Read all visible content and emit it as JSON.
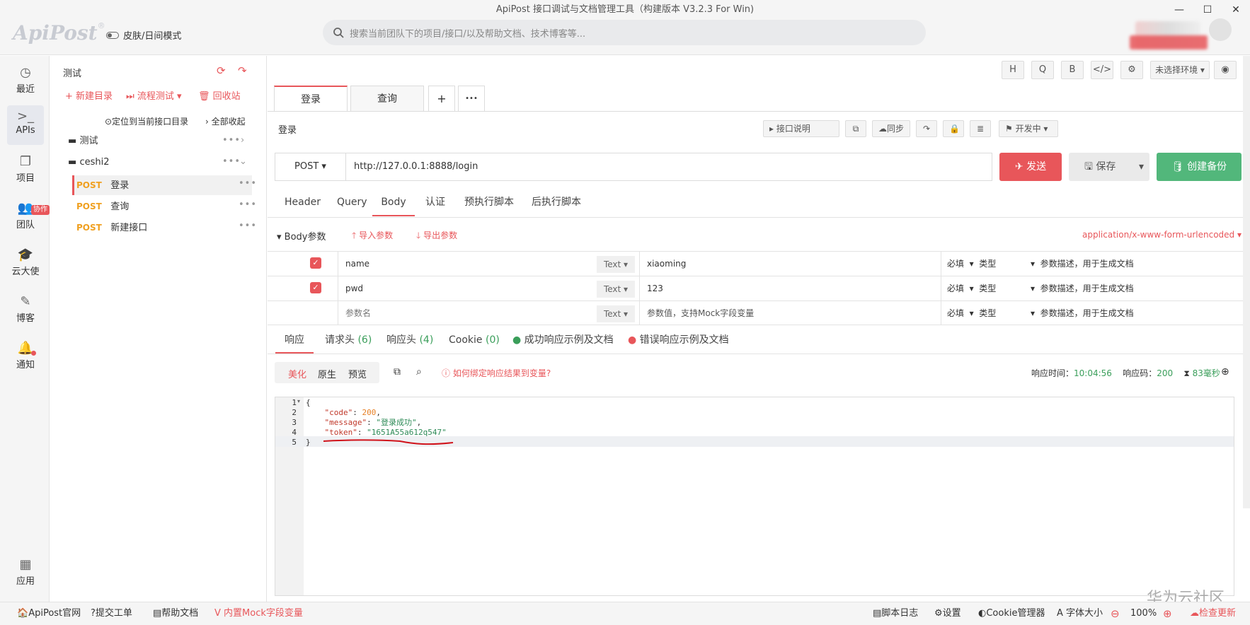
{
  "window": {
    "title": "ApiPost 接口调试与文档管理工具（构建版本 V3.2.3 For Win)",
    "min": "—",
    "max": "☐",
    "close": "✕"
  },
  "top": {
    "logo": "ApiPost",
    "logo_mark": "®",
    "skin_label": "皮肤/日间模式",
    "search_placeholder": "搜索当前团队下的项目/接口/以及帮助文档、技术博客等..."
  },
  "nav": {
    "recent": "最近",
    "apis": "APIs",
    "project": "项目",
    "team": "团队",
    "team_badge": "协作",
    "cloud": "云大使",
    "blog": "博客",
    "notify": "通知",
    "apps": "应用"
  },
  "tree": {
    "title": "测试",
    "new_dir": "新建目录",
    "flow_test": "流程测试",
    "recycle": "回收站",
    "locate": "定位到当前接口目录",
    "collapse_all": "全部收起",
    "folders": [
      {
        "name": "测试"
      },
      {
        "name": "ceshi2"
      }
    ],
    "items": [
      {
        "method": "POST",
        "name": "登录"
      },
      {
        "method": "POST",
        "name": "查询"
      },
      {
        "method": "POST",
        "name": "新建接口"
      }
    ]
  },
  "toolbar": {
    "h": "H",
    "q": "Q",
    "b": "B",
    "code": "</>",
    "tune": "⚙",
    "env": "未选择环境",
    "eye": "◉"
  },
  "tabs": [
    {
      "label": "登录"
    },
    {
      "label": "查询"
    }
  ],
  "tab_add": "+",
  "tab_more": "•••",
  "api": {
    "name": "登录",
    "doc_btn": "接口说明",
    "sync": "同步",
    "status": "开发中",
    "method": "POST",
    "url": "http://127.0.0.1:8888/login",
    "send": "发送",
    "save": "保存",
    "create_backup": "创建备份"
  },
  "sections": {
    "header": "Header",
    "query": "Query",
    "body": "Body",
    "auth": "认证",
    "pre": "预执行脚本",
    "post": "后执行脚本"
  },
  "body": {
    "title": "Body参数",
    "import": "导入参数",
    "export": "导出参数",
    "content_type": "application/x-www-form-urlencoded",
    "rows": [
      {
        "key": "name",
        "type": "Text",
        "value": "xiaoming",
        "required": "必填",
        "vtype": "类型",
        "desc": "参数描述，用于生成文档"
      },
      {
        "key": "pwd",
        "type": "Text",
        "value": "123",
        "required": "必填",
        "vtype": "类型",
        "desc": "参数描述，用于生成文档"
      },
      {
        "key": "参数名",
        "type": "Text",
        "value": "参数值，支持Mock字段变量",
        "required": "必填",
        "vtype": "类型",
        "desc": "参数描述，用于生成文档"
      }
    ]
  },
  "resp": {
    "tab_resp": "响应",
    "tab_req_head": "请求头",
    "req_head_count": "(6)",
    "tab_resp_head": "响应头",
    "resp_head_count": "(4)",
    "tab_cookie": "Cookie",
    "cookie_count": "(0)",
    "tab_success": "成功响应示例及文档",
    "tab_error": "错误响应示例及文档",
    "view_pretty": "美化",
    "view_raw": "原生",
    "view_preview": "预览",
    "bind_help": "如何绑定响应结果到变量?",
    "time_label": "响应时间：",
    "time": "10:04:56",
    "code_label": "响应码：",
    "code": "200",
    "duration": "83毫秒"
  },
  "code": {
    "lines": [
      "{",
      "\"code\": 200,",
      "\"message\": \"登录成功\",",
      "\"token\": \"1651A55a612q547\"",
      "}"
    ],
    "k_code": "\"code\"",
    "v_code": "200",
    "k_msg": "\"message\"",
    "v_msg": "\"登录成功\"",
    "k_token": "\"token\"",
    "v_token": "\"1651A55a612q547\""
  },
  "status": {
    "site": "ApiPost官网",
    "ticket": "提交工单",
    "help": "帮助文档",
    "mock": "内置Mock字段变量",
    "log": "脚本日志",
    "settings": "设置",
    "cookie_mgr": "Cookie管理器",
    "font": "字体大小",
    "zoom": "100%",
    "update": "检查更新"
  },
  "watermark": "华为云社区",
  "colors": {
    "accent": "#e8565a",
    "green": "#52b77b",
    "post": "#f0a020"
  }
}
